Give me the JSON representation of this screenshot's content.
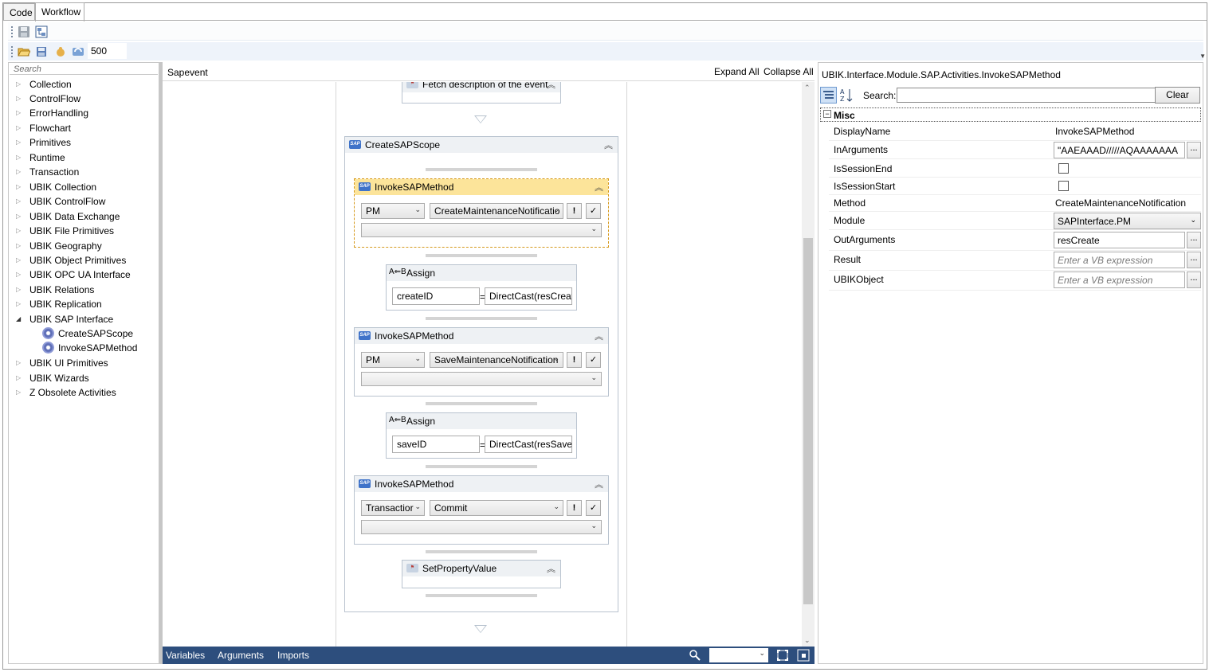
{
  "tabs": {
    "code": "Code",
    "workflow": "Workflow"
  },
  "toolbar": {
    "items_count": "500"
  },
  "toolbox": {
    "search_placeholder": "Search",
    "categories": [
      "Collection",
      "ControlFlow",
      "ErrorHandling",
      "Flowchart",
      "Primitives",
      "Runtime",
      "Transaction",
      "UBIK Collection",
      "UBIK ControlFlow",
      "UBIK Data Exchange",
      "UBIK File Primitives",
      "UBIK Geography",
      "UBIK Object Primitives",
      "UBIK OPC UA Interface",
      "UBIK Relations",
      "UBIK Replication",
      "UBIK SAP Interface"
    ],
    "sap_children": [
      "CreateSAPScope",
      "InvokeSAPMethod"
    ],
    "more_categories": [
      "UBIK UI Primitives",
      "UBIK Wizards",
      "Z Obsolete Activities"
    ]
  },
  "designer": {
    "breadcrumb": "Sapevent",
    "expand_all": "Expand All",
    "collapse_all": "Collapse All",
    "fetch_activity": "Fetch description of the event",
    "scope_title": "CreateSAPScope",
    "invoke1": {
      "title": "InvokeSAPMethod",
      "module": "PM",
      "method": "CreateMaintenanceNotificatio"
    },
    "assign1": {
      "title": "Assign",
      "to": "createID",
      "value": "DirectCast(resCreate"
    },
    "invoke2": {
      "title": "InvokeSAPMethod",
      "module": "PM",
      "method": "SaveMaintenanceNotification"
    },
    "assign2": {
      "title": "Assign",
      "to": "saveID",
      "value": "DirectCast(resSave(C"
    },
    "invoke3": {
      "title": "InvokeSAPMethod",
      "module": "Transactior",
      "method": "Commit"
    },
    "setprop": {
      "title": "SetPropertyValue"
    },
    "btn_exclaim": "!",
    "btn_check": "✓",
    "bottom": {
      "variables": "Variables",
      "arguments": "Arguments",
      "imports": "Imports"
    }
  },
  "properties": {
    "type_name": "UBIK.Interface.Module.SAP.Activities.InvokeSAPMethod",
    "search_label": "Search:",
    "clear": "Clear",
    "category": "Misc",
    "rows": [
      {
        "name": "DisplayName",
        "value": "InvokeSAPMethod"
      },
      {
        "name": "InArguments",
        "value": "\"AAEAAAD/////AQAAAAAAA"
      },
      {
        "name": "IsSessionEnd",
        "value": ""
      },
      {
        "name": "IsSessionStart",
        "value": ""
      },
      {
        "name": "Method",
        "value": "CreateMaintenanceNotification"
      },
      {
        "name": "Module",
        "value": "SAPInterface.PM"
      },
      {
        "name": "OutArguments",
        "value": "resCreate"
      },
      {
        "name": "Result",
        "value": "Enter a VB expression"
      },
      {
        "name": "UBIKObject",
        "value": "Enter a VB expression"
      }
    ],
    "ellipsis": "..."
  },
  "colors": {
    "accent": "#2d4e7d",
    "selected_header": "#fce49a",
    "selected_border": "#d69a1e",
    "sap_icon": "#3f73c9"
  },
  "icons": [
    "save-icon",
    "workflow-icon",
    "open-folder-icon",
    "save-all-icon",
    "hand-icon",
    "refresh-icon",
    "gear-icon",
    "search-icon",
    "fit-to-screen-icon",
    "overview-icon",
    "categorized-icon",
    "alphabetical-icon"
  ]
}
